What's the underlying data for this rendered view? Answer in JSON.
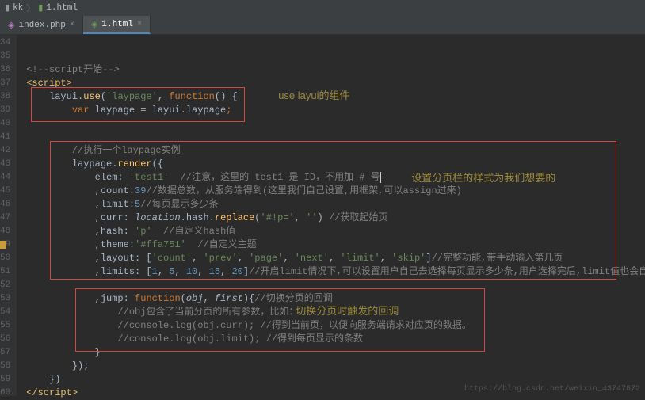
{
  "titlebar": {
    "folder": "kk",
    "file": "1.html"
  },
  "tabs": [
    {
      "icon": "php",
      "label": "index.php",
      "active": false
    },
    {
      "icon": "html",
      "label": "1.html",
      "active": true
    }
  ],
  "line_start": 34,
  "line_end": 60,
  "marked_line": 49,
  "code": {
    "l36_cmt": "<!--script开始-->",
    "l37_open": "script",
    "l38_a": "layui.",
    "l38_use": "use",
    "l38_b": "(",
    "l38_str": "'laypage'",
    "l38_c": ", ",
    "l38_fn": "function",
    "l38_d": "() {",
    "l39_a": "var ",
    "l39_b": "laypage = layui.laypage",
    "l39_sc": ";",
    "l42_cmt": "//执行一个laypage实例",
    "l43_a": "laypage.",
    "l43_render": "render",
    "l43_b": "({",
    "l44_a": "elem: ",
    "l44_str": "'test1'",
    "l44_cmt": "  //注意，这里的 test1 是 ID，不用加 # 号",
    "l45_a": ",count:",
    "l45_num": "39",
    "l45_cmt": "//数据总数，从服务端得到(这里我们自己设置,用框架,可以assign过来)",
    "l46_a": ",limit:",
    "l46_num": "5",
    "l46_cmt": "//每页显示多少条",
    "l47_a": ",curr: ",
    "l47_loc": "location",
    "l47_b": ".hash.",
    "l47_rep": "replace",
    "l47_c": "(",
    "l47_str1": "'#!p='",
    "l47_d": ", ",
    "l47_str2": "''",
    "l47_e": ") ",
    "l47_cmt": "//获取起始页",
    "l48_a": ",hash: ",
    "l48_str": "'p'",
    "l48_cmt": "  //自定义hash值",
    "l49_a": ",theme:",
    "l49_str": "'#ffa751'",
    "l49_cmt": "  //自定义主题",
    "l50_a": ",layout: [",
    "l50_s1": "'count'",
    "l50_c1": ", ",
    "l50_s2": "'prev'",
    "l50_c2": ", ",
    "l50_s3": "'page'",
    "l50_c3": ", ",
    "l50_s4": "'next'",
    "l50_c4": ", ",
    "l50_s5": "'limit'",
    "l50_c5": ", ",
    "l50_s6": "'skip'",
    "l50_b": "]",
    "l50_cmt": "//完整功能,带手动输入第几页",
    "l51_a": ",limits: [",
    "l51_n1": "1",
    "l51_c1": ", ",
    "l51_n2": "5",
    "l51_c2": ", ",
    "l51_n3": "10",
    "l51_c3": ", ",
    "l51_n4": "15",
    "l51_c4": ", ",
    "l51_n5": "20",
    "l51_b": "]",
    "l51_cmt": "//开启limit情况下,可以设置用户自己去选择每页显示多少条,用户选择完后,limit值也会自动改变",
    "l53_a": ",jump: ",
    "l53_fn": "function",
    "l53_b": "(",
    "l53_p1": "obj",
    "l53_c": ", ",
    "l53_p2": "first",
    "l53_d": "){",
    "l53_cmt": "//切换分页的回调",
    "l54_cmt": "//obj包含了当前分页的所有参数，比如：",
    "l55_cmt": "//console.log(obj.curr); //得到当前页，以便向服务端请求对应页的数据。",
    "l56_cmt": "//console.log(obj.limit); //得到每页显示的条数",
    "l57": "}",
    "l58": "});",
    "l59": "})",
    "l60_close": "script"
  },
  "annotations": {
    "a1": "use layui的组件",
    "a2": "设置分页栏的样式为我们想要的",
    "a3": "切换分页时触发的回调"
  },
  "watermark": "https://blog.csdn.net/weixin_43747872"
}
